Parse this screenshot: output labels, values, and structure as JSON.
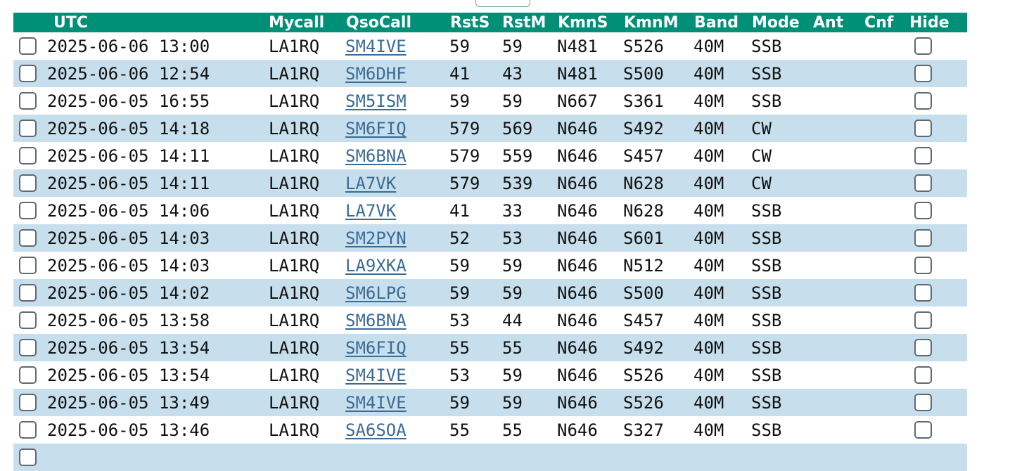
{
  "headers": [
    "UTC",
    "Mycall",
    "QsoCall",
    "RstS",
    "RstM",
    "KmnS",
    "KmnM",
    "Band",
    "Mode",
    "Ant",
    "Cnf",
    "Hide"
  ],
  "rows": [
    {
      "utc": "2025-06-06 13:00",
      "mycall": "LA1RQ",
      "qsocall": "SM4IVE",
      "rsts": "59",
      "rstm": "59",
      "kmns": "N481",
      "kmnm": "S526",
      "band": "40M",
      "mode": "SSB"
    },
    {
      "utc": "2025-06-06 12:54",
      "mycall": "LA1RQ",
      "qsocall": "SM6DHF",
      "rsts": "41",
      "rstm": "43",
      "kmns": "N481",
      "kmnm": "S500",
      "band": "40M",
      "mode": "SSB"
    },
    {
      "utc": "2025-06-05 16:55",
      "mycall": "LA1RQ",
      "qsocall": "SM5ISM",
      "rsts": "59",
      "rstm": "59",
      "kmns": "N667",
      "kmnm": "S361",
      "band": "40M",
      "mode": "SSB"
    },
    {
      "utc": "2025-06-05 14:18",
      "mycall": "LA1RQ",
      "qsocall": "SM6FIQ",
      "rsts": "579",
      "rstm": "569",
      "kmns": "N646",
      "kmnm": "S492",
      "band": "40M",
      "mode": "CW"
    },
    {
      "utc": "2025-06-05 14:11",
      "mycall": "LA1RQ",
      "qsocall": "SM6BNA",
      "rsts": "579",
      "rstm": "559",
      "kmns": "N646",
      "kmnm": "S457",
      "band": "40M",
      "mode": "CW"
    },
    {
      "utc": "2025-06-05 14:11",
      "mycall": "LA1RQ",
      "qsocall": "LA7VK",
      "rsts": "579",
      "rstm": "539",
      "kmns": "N646",
      "kmnm": "N628",
      "band": "40M",
      "mode": "CW"
    },
    {
      "utc": "2025-06-05 14:06",
      "mycall": "LA1RQ",
      "qsocall": "LA7VK",
      "rsts": "41",
      "rstm": "33",
      "kmns": "N646",
      "kmnm": "N628",
      "band": "40M",
      "mode": "SSB"
    },
    {
      "utc": "2025-06-05 14:03",
      "mycall": "LA1RQ",
      "qsocall": "SM2PYN",
      "rsts": "52",
      "rstm": "53",
      "kmns": "N646",
      "kmnm": "S601",
      "band": "40M",
      "mode": "SSB"
    },
    {
      "utc": "2025-06-05 14:03",
      "mycall": "LA1RQ",
      "qsocall": "LA9XKA",
      "rsts": "59",
      "rstm": "59",
      "kmns": "N646",
      "kmnm": "N512",
      "band": "40M",
      "mode": "SSB"
    },
    {
      "utc": "2025-06-05 14:02",
      "mycall": "LA1RQ",
      "qsocall": "SM6LPG",
      "rsts": "59",
      "rstm": "59",
      "kmns": "N646",
      "kmnm": "S500",
      "band": "40M",
      "mode": "SSB"
    },
    {
      "utc": "2025-06-05 13:58",
      "mycall": "LA1RQ",
      "qsocall": "SM6BNA",
      "rsts": "53",
      "rstm": "44",
      "kmns": "N646",
      "kmnm": "S457",
      "band": "40M",
      "mode": "SSB"
    },
    {
      "utc": "2025-06-05 13:54",
      "mycall": "LA1RQ",
      "qsocall": "SM6FIQ",
      "rsts": "55",
      "rstm": "55",
      "kmns": "N646",
      "kmnm": "S492",
      "band": "40M",
      "mode": "SSB"
    },
    {
      "utc": "2025-06-05 13:54",
      "mycall": "LA1RQ",
      "qsocall": "SM4IVE",
      "rsts": "53",
      "rstm": "59",
      "kmns": "N646",
      "kmnm": "S526",
      "band": "40M",
      "mode": "SSB"
    },
    {
      "utc": "2025-06-05 13:49",
      "mycall": "LA1RQ",
      "qsocall": "SM4IVE",
      "rsts": "59",
      "rstm": "59",
      "kmns": "N646",
      "kmnm": "S526",
      "band": "40M",
      "mode": "SSB"
    },
    {
      "utc": "2025-06-05 13:46",
      "mycall": "LA1RQ",
      "qsocall": "SA6SOA",
      "rsts": "55",
      "rstm": "55",
      "kmns": "N646",
      "kmnm": "S327",
      "band": "40M",
      "mode": "SSB"
    },
    {
      "utc": "",
      "mycall": "",
      "qsocall": "",
      "rsts": "",
      "rstm": "",
      "kmns": "",
      "kmnm": "",
      "band": "",
      "mode": ""
    }
  ],
  "colors": {
    "header_bg": "#009077",
    "header_text": "#ffffff",
    "row_alt_bg": "#c7dfec",
    "link": "#3a6b94"
  }
}
